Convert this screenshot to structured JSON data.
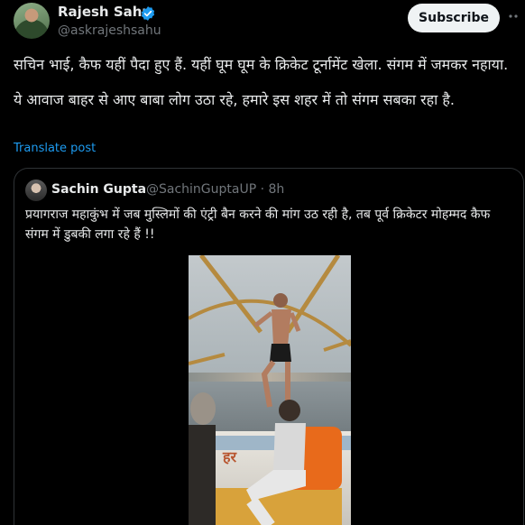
{
  "post": {
    "author": "Rajesh Sahu",
    "handle": "@askrajeshsahu",
    "subscribe_label": "Subscribe",
    "paragraph1": "सचिन भाई, कैफ यहीं पैदा हुए हैं. यहीं घूम घूम के क्रिकेट टूर्नामेंट खेला. संगम में जमकर नहाया.",
    "paragraph2": "ये आवाज बाहर से आए बाबा लोग उठा रहे, हमारे इस शहर में तो संगम सबका रहा है.",
    "translate_label": "Translate post"
  },
  "quote": {
    "author": "Sachin Gupta",
    "handle_time": "@SachinGuptaUP · 8h",
    "text": "प्रयागराज महाकुंभ में जब मुस्लिमों की एंट्री बैन करने की मांग उठ रही है, तब पूर्व क्रिकेटर मोहम्मद कैफ संगम में डुबकी लगा रहे हैं !!"
  },
  "video": {
    "boat_paint": "हर"
  },
  "colors": {
    "background": "#000000",
    "text": "#e7e9ea",
    "muted": "#71767b",
    "link": "#1d9bf0",
    "border": "#2f3336"
  },
  "icons": {
    "verified": "verified-badge-icon",
    "more": "more-icon"
  }
}
